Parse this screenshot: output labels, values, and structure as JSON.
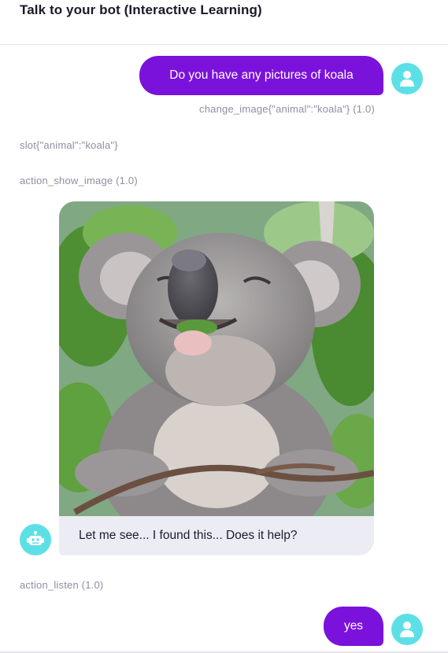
{
  "header": {
    "title": "Talk to your bot (Interactive Learning)"
  },
  "conversation": {
    "user_message_1": "Do you have any pictures of koala",
    "intent_1": "change_image{\"animal\":\"koala\"} (1.0)",
    "slot_event": "slot{\"animal\":\"koala\"}",
    "action_1": "action_show_image (1.0)",
    "bot_message": "Let me see... I found this... Does it help?",
    "action_2": "action_listen (1.0)",
    "user_message_2": "yes"
  },
  "icons": {
    "user_avatar": "user-icon",
    "bot_avatar": "robot-icon",
    "avatar_color": "#5ce0e6"
  },
  "colors": {
    "user_bubble": "#7a12dc",
    "bot_bubble": "#ececf4",
    "meta_text": "#8d8fa3"
  },
  "image": {
    "subject": "koala"
  }
}
